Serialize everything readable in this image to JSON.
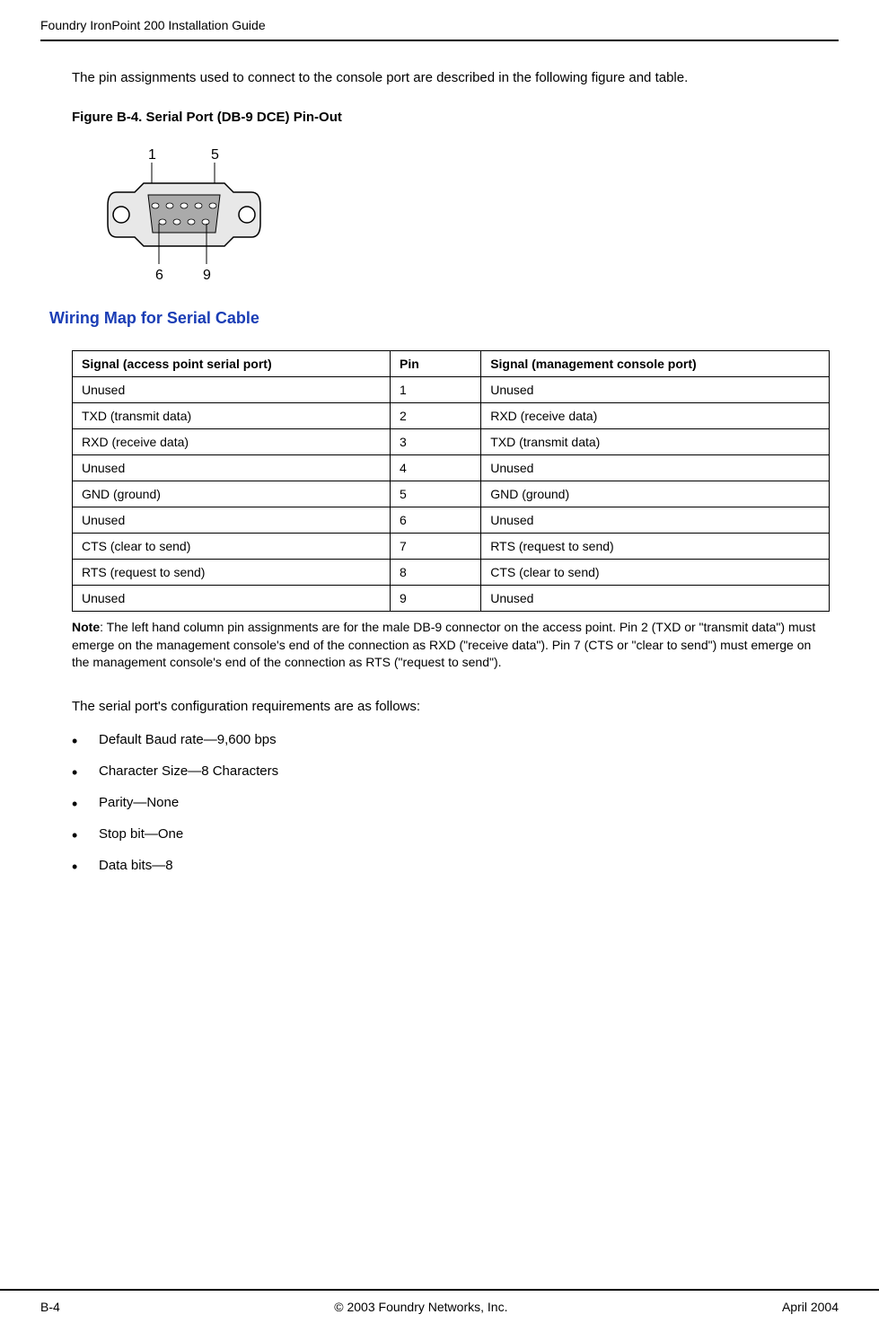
{
  "header": {
    "title": "Foundry IronPoint 200 Installation Guide"
  },
  "intro": "The pin assignments used to connect to the console port are described in the following figure and table.",
  "figure": {
    "caption": "Figure B-4.  Serial Port (DB-9 DCE) Pin-Out",
    "pin_labels": {
      "top_left": "1",
      "top_right": "5",
      "bottom_left": "6",
      "bottom_right": "9"
    }
  },
  "section_title": "Wiring Map for Serial Cable",
  "table": {
    "headers": [
      "Signal (access point serial port)",
      "Pin",
      "Signal (management console port)"
    ],
    "rows": [
      [
        "Unused",
        "1",
        "Unused"
      ],
      [
        "TXD (transmit data)",
        "2",
        "RXD (receive data)"
      ],
      [
        "RXD (receive data)",
        "3",
        "TXD (transmit data)"
      ],
      [
        "Unused",
        "4",
        "Unused"
      ],
      [
        "GND (ground)",
        "5",
        "GND (ground)"
      ],
      [
        "Unused",
        "6",
        "Unused"
      ],
      [
        "CTS (clear to send)",
        "7",
        "RTS (request to send)"
      ],
      [
        "RTS (request to send)",
        "8",
        "CTS (clear to send)"
      ],
      [
        "Unused",
        "9",
        "Unused"
      ]
    ]
  },
  "note": {
    "label": "Note",
    "text": ": The left hand column pin assignments are for the male DB-9 connector on the access point. Pin 2 (TXD or \"transmit data\") must emerge on the management console's end of the connection as RXD (\"receive data\"). Pin 7 (CTS or \"clear to send\") must emerge on the management console's end of the connection as RTS (\"request to send\")."
  },
  "config": {
    "intro": "The serial port's configuration requirements are as follows:",
    "items": [
      "Default Baud rate—9,600 bps",
      "Character Size—8 Characters",
      "Parity—None",
      "Stop bit—One",
      "Data bits—8"
    ]
  },
  "footer": {
    "page": "B-4",
    "copyright": "© 2003 Foundry Networks, Inc.",
    "date": "April 2004"
  }
}
